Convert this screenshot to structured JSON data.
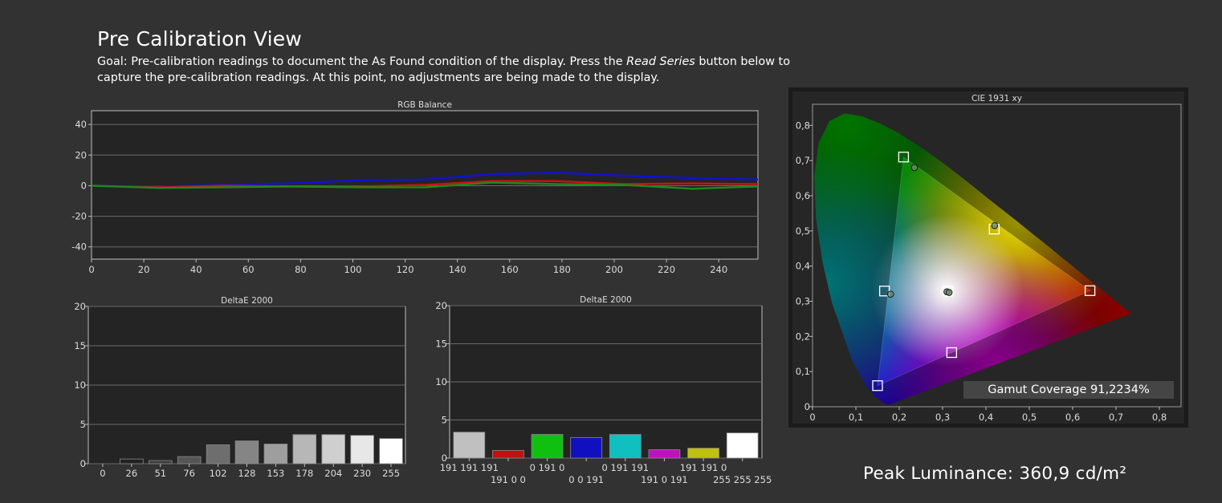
{
  "page": {
    "title": "Pre Calibration View",
    "goal_prefix": "Goal: Pre-calibration readings to document the As Found condition of the display. Press the ",
    "goal_emphasis": "Read Series",
    "goal_suffix": " button below to capture the pre-calibration readings. At this point, no adjustments are being made to the display.",
    "gamut_coverage": "Gamut Coverage 91,2234%",
    "peak_luminance": "Peak Luminance: 360,9 cd/m²"
  },
  "colors": {
    "background": "#323232",
    "plot_bg": "#242424",
    "red": "#d01010",
    "green": "#1a8a1a",
    "blue": "#1010d8"
  },
  "chart_data": [
    {
      "type": "line",
      "title": "RGB Balance",
      "xlim": [
        0,
        255
      ],
      "ylim": [
        -48,
        49
      ],
      "xticks": [
        0,
        20,
        40,
        60,
        80,
        100,
        120,
        140,
        160,
        180,
        200,
        220,
        240
      ],
      "yticks": [
        40,
        20,
        0,
        -20,
        -40
      ],
      "grid": true,
      "series": [
        {
          "color": "#1010d8",
          "x": [
            0,
            26,
            51,
            76,
            102,
            128,
            153,
            178,
            204,
            230,
            255
          ],
          "y": [
            0,
            -0.5,
            0.5,
            1.5,
            3.5,
            4,
            7.5,
            8.5,
            6.5,
            5,
            4
          ]
        },
        {
          "color": "#d01010",
          "x": [
            0,
            26,
            51,
            76,
            102,
            128,
            153,
            178,
            204,
            230,
            255
          ],
          "y": [
            0,
            -1,
            0,
            -0.5,
            -0.5,
            0.5,
            3,
            3,
            1,
            1.5,
            1
          ]
        },
        {
          "color": "#1a8a1a",
          "x": [
            0,
            26,
            51,
            76,
            102,
            128,
            153,
            178,
            204,
            230,
            255
          ],
          "y": [
            0,
            -1.5,
            -1,
            -0.5,
            -1,
            -1,
            2,
            1,
            0.5,
            -2,
            -0.5
          ]
        }
      ]
    },
    {
      "type": "bar",
      "title": "DeltaE 2000",
      "ylim": [
        0,
        20
      ],
      "yticks": [
        0,
        5,
        10,
        15,
        20
      ],
      "categories": [
        "0",
        "26",
        "51",
        "76",
        "102",
        "128",
        "153",
        "178",
        "204",
        "230",
        "255"
      ],
      "values": [
        0,
        0.6,
        0.4,
        0.9,
        2.4,
        2.9,
        2.5,
        3.7,
        3.7,
        3.6,
        3.2
      ],
      "bar_colors": [
        "#0f0f0f",
        "#222222",
        "#3d3d3d",
        "#555555",
        "#6e6e6e",
        "#858585",
        "#9e9e9e",
        "#b7b7b7",
        "#cfcfcf",
        "#e7e7e7",
        "#ffffff"
      ]
    },
    {
      "type": "bar",
      "title": "DeltaE 2000",
      "ylim": [
        0,
        20
      ],
      "yticks": [
        0,
        5,
        10,
        15,
        20
      ],
      "categories": [
        "191 191 191",
        "191 0 0",
        "0 191 0",
        "0 0 191",
        "0 191 191",
        "191 0 191",
        "191 191 0",
        "255 255 255"
      ],
      "values": [
        3.4,
        1.0,
        3.1,
        2.7,
        3.1,
        1.1,
        1.3,
        3.3
      ],
      "bar_colors": [
        "#c0c0c0",
        "#c01010",
        "#10c010",
        "#1010c0",
        "#10c0c0",
        "#c010c0",
        "#c0c010",
        "#ffffff"
      ]
    },
    {
      "type": "scatter",
      "title": "CIE 1931 xy",
      "xlim": [
        0,
        0.85
      ],
      "ylim": [
        0,
        0.86
      ],
      "xticks": [
        "0",
        "0,1",
        "0,2",
        "0,3",
        "0,4",
        "0,5",
        "0,6",
        "0,7",
        "0,8"
      ],
      "yticks": [
        "0",
        "0,1",
        "0,2",
        "0,3",
        "0,4",
        "0,5",
        "0,6",
        "0,7",
        "0,8"
      ],
      "targets": [
        {
          "x": 0.64,
          "y": 0.33
        },
        {
          "x": 0.21,
          "y": 0.71
        },
        {
          "x": 0.15,
          "y": 0.06
        },
        {
          "x": 0.419,
          "y": 0.505
        },
        {
          "x": 0.321,
          "y": 0.154
        },
        {
          "x": 0.166,
          "y": 0.329
        },
        {
          "x": 0.3127,
          "y": 0.329
        }
      ],
      "measured": [
        {
          "x": 0.235,
          "y": 0.68
        },
        {
          "x": 0.42,
          "y": 0.515
        },
        {
          "x": 0.18,
          "y": 0.32
        },
        {
          "x": 0.31,
          "y": 0.327
        },
        {
          "x": 0.315,
          "y": 0.325
        }
      ],
      "gamut_triangle": [
        {
          "x": 0.64,
          "y": 0.33
        },
        {
          "x": 0.21,
          "y": 0.71
        },
        {
          "x": 0.15,
          "y": 0.06
        }
      ]
    }
  ]
}
